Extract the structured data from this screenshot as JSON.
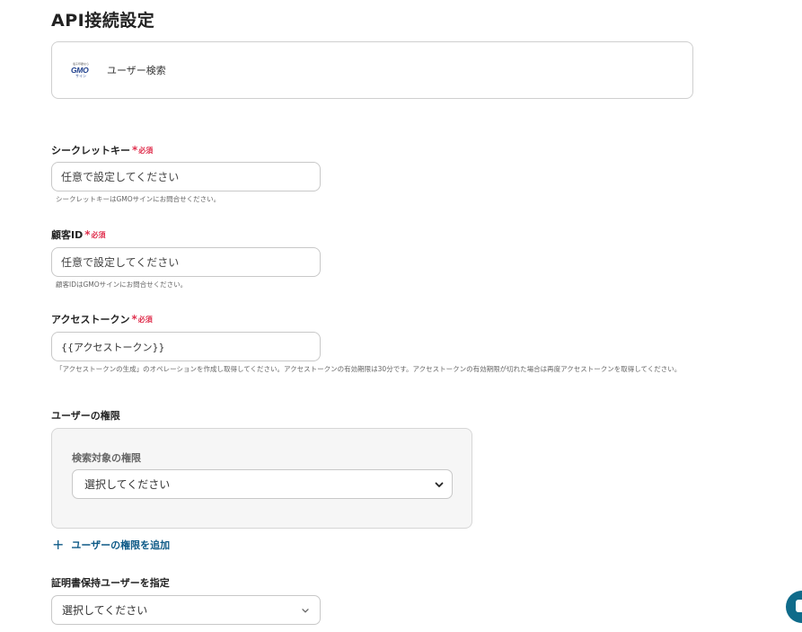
{
  "page": {
    "title": "API接続設定"
  },
  "app": {
    "logo_line1": "電子印鑑なら",
    "logo_brand": "GMO",
    "logo_line3": "サイン",
    "action": "ユーザー検索"
  },
  "required_label": "必須",
  "required_mark": "*",
  "fields": {
    "secret_key": {
      "label": "シークレットキー",
      "placeholder": "任意で設定してください",
      "help": "シークレットキーはGMOサインにお問合せください。"
    },
    "customer_id": {
      "label": "顧客ID",
      "placeholder": "任意で設定してください",
      "help": "顧客IDはGMOサインにお問合せください。"
    },
    "access_token": {
      "label": "アクセストークン",
      "value": "{{アクセストークン}}",
      "help": "「アクセストークンの生成」のオペレーションを作成し取得してください。アクセストークンの有効期限は30分です。アクセストークンの有効期限が切れた場合は再度アクセストークンを取得してください。"
    }
  },
  "permissions": {
    "label": "ユーザーの権限",
    "sub_label": "検索対象の権限",
    "select_value": "選択してください",
    "add_button": "ユーザーの権限を追加"
  },
  "cert_user": {
    "label": "証明書保持ユーザーを指定",
    "select_value": "選択してください"
  },
  "colors": {
    "accent": "#0e5a87",
    "required": "#e0304e",
    "chat": "#0f6b8a"
  }
}
